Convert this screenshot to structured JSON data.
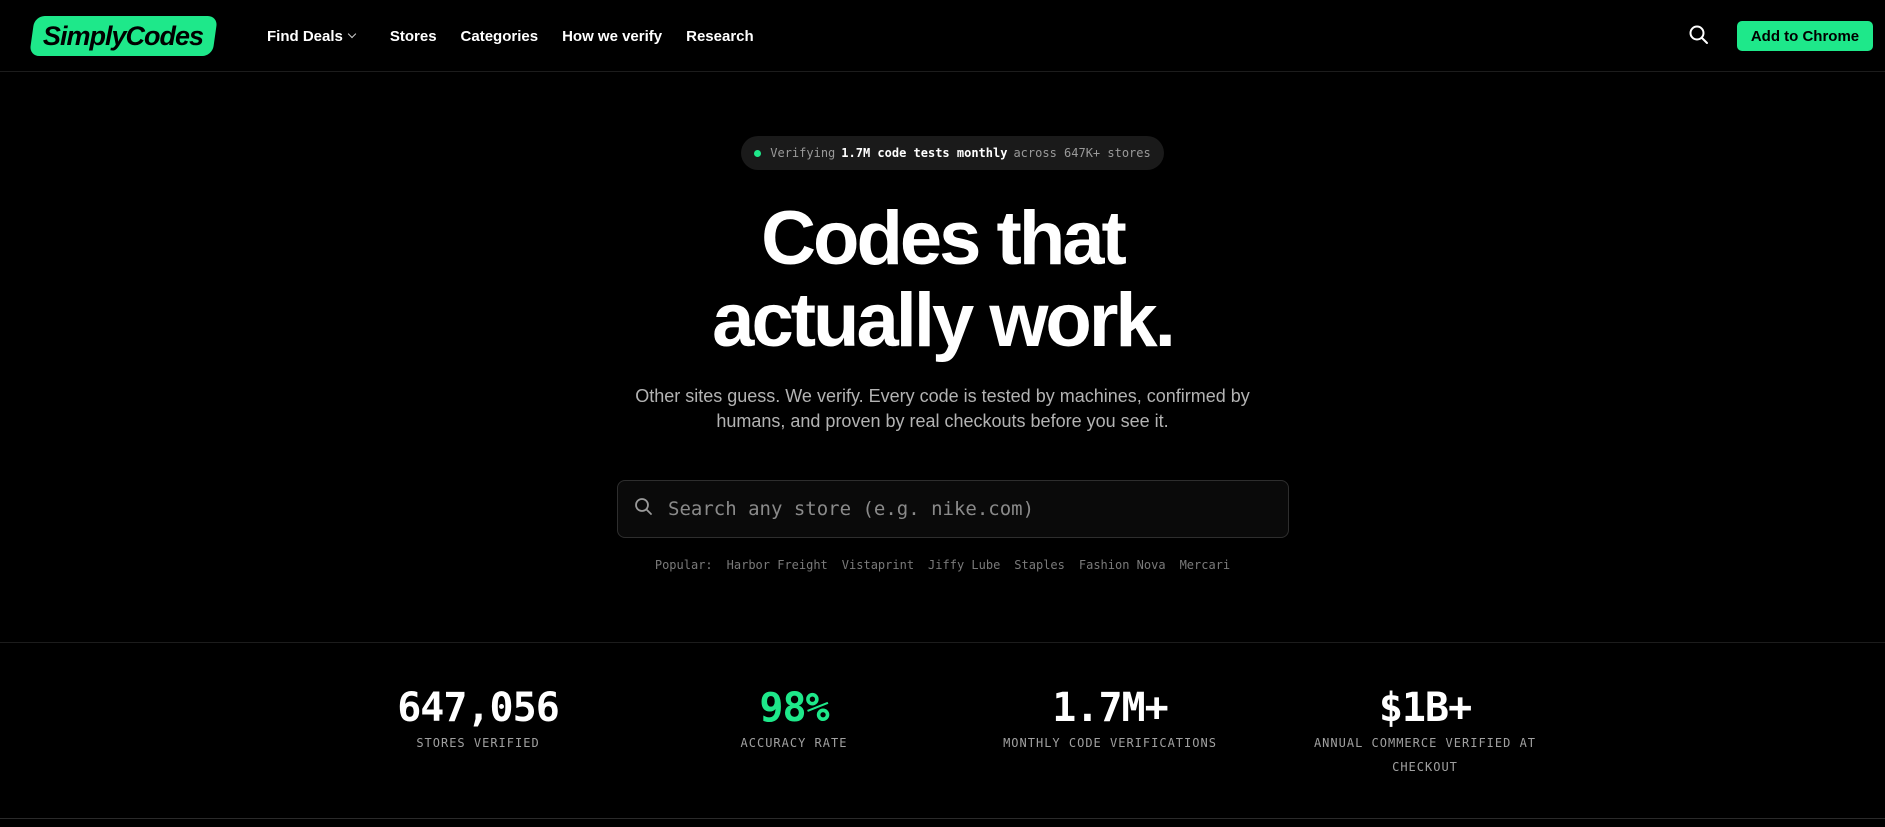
{
  "header": {
    "logo": "SimplyCodes",
    "nav": [
      "Find Deals",
      "Stores",
      "Categories",
      "How we verify",
      "Research"
    ],
    "cta": "Add to Chrome",
    "icons": {
      "search": "search-icon",
      "dropdown": "chevron-down-icon"
    }
  },
  "hero": {
    "pill_prefix": "Verifying",
    "pill_bold": "1.7M code tests monthly",
    "pill_suffix": "across 647K+ stores",
    "headline_line1": "Codes that",
    "headline_line2": "actually work.",
    "subtitle": "Other sites guess. We verify. Every code is tested by machines, confirmed by humans, and proven by real checkouts before you see it.",
    "search_placeholder": "Search any store (e.g. nike.com)",
    "popular_label": "Popular:",
    "popular": [
      "Harbor Freight",
      "Vistaprint",
      "Jiffy Lube",
      "Staples",
      "Fashion Nova",
      "Mercari"
    ]
  },
  "stats": [
    {
      "value": "647,056",
      "label": "STORES VERIFIED"
    },
    {
      "value": "98%",
      "label": "ACCURACY RATE"
    },
    {
      "value": "1.7M+",
      "label": "MONTHLY CODE VERIFICATIONS"
    },
    {
      "value": "$1B+",
      "label": "ANNUAL COMMERCE VERIFIED AT CHECKOUT"
    }
  ],
  "colors": {
    "accent": "#1ee88a",
    "background": "#000000"
  }
}
